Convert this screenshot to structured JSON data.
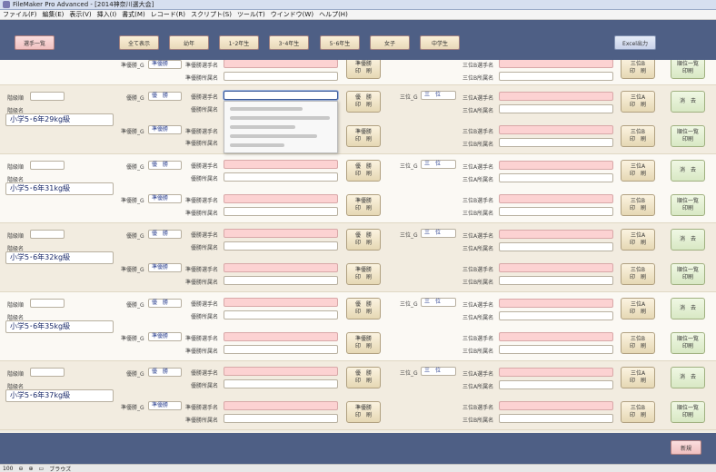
{
  "window": {
    "title": "FileMaker Pro Advanced - [2014神奈川選大会]"
  },
  "menu": [
    "ファイル(F)",
    "編集(E)",
    "表示(V)",
    "挿入(I)",
    "書式(M)",
    "レコード(R)",
    "スクリプト(S)",
    "ツール(T)",
    "ウインドウ(W)",
    "ヘルプ(H)"
  ],
  "header_buttons": {
    "list": "選手一覧",
    "all": "全て表示",
    "kinder": "幼年",
    "g12": "1･2年生",
    "g34": "3･4年生",
    "g56": "5･6年生",
    "girls": "女子",
    "junior": "中学生",
    "excel": "Excel出力"
  },
  "labels": {
    "class_no": "階級順",
    "class_name": "階級名",
    "win_g": "優勝_G",
    "runner_g": "準優勝_G",
    "third_g": "三位_G",
    "win_name": "優勝選手名",
    "win_club": "優勝所属名",
    "runner_name": "準優勝選手名",
    "runner_club": "準優勝所属名",
    "thirdA_name": "三位A選手名",
    "thirdA_club": "三位A所属名",
    "thirdB_name": "三位B選手名",
    "thirdB_club": "三位B所属名"
  },
  "buttons": {
    "print_win": "優　勝\n印　刷",
    "print_runner": "準優勝\n印　刷",
    "print_thirdA": "三位A\n印　刷",
    "print_thirdB": "三位B\n印　刷",
    "delete": "消　去",
    "print_list": "順位一覧\n印刷"
  },
  "values": {
    "win": "優　勝",
    "runner": "準優勝",
    "third": "三　位"
  },
  "records": [
    {
      "class_name": "小学5･6年29kg級"
    },
    {
      "class_name": "小学5･6年31kg級"
    },
    {
      "class_name": "小学5･6年32kg級"
    },
    {
      "class_name": "小学5･6年35kg級"
    },
    {
      "class_name": "小学5･6年37kg級"
    }
  ],
  "footer": {
    "new_label": "新規"
  },
  "status": {
    "zoom": "100",
    "mode": "ブラウズ"
  }
}
